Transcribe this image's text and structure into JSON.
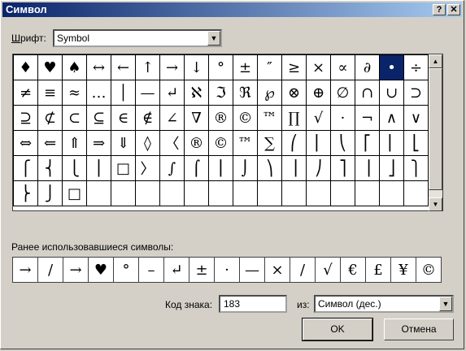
{
  "window": {
    "title": "Символ",
    "help": "?",
    "close": "X"
  },
  "font": {
    "label_pre": "Ш",
    "label_post": "рифт:",
    "label_ul": "",
    "value": "Symbol"
  },
  "grid": {
    "rows": [
      [
        "♦",
        "♥",
        "♠",
        "↔",
        "←",
        "↑",
        "→",
        "↓",
        "°",
        "±",
        "″",
        "≥",
        "×",
        "∝",
        "∂",
        "•",
        "÷"
      ],
      [
        "≠",
        "≡",
        "≈",
        "…",
        "│",
        "—",
        "↵",
        "ℵ",
        "ℑ",
        "ℜ",
        "℘",
        "⊗",
        "⊕",
        "∅",
        "∩",
        "∪",
        "⊃"
      ],
      [
        "⊇",
        "⊄",
        "⊂",
        "⊆",
        "∈",
        "∉",
        "∠",
        "∇",
        "®",
        "©",
        "™",
        "∏",
        "√",
        "·",
        "¬",
        "∧",
        "∨"
      ],
      [
        "⇔",
        "⇐",
        "⇑",
        "⇒",
        "⇓",
        "◊",
        "〈",
        "®",
        "©",
        "™",
        "∑",
        "⎛",
        "⎜",
        "⎝",
        "⎡",
        "⎢",
        "⎣"
      ],
      [
        "⎧",
        "⎨",
        "⎩",
        "⎪",
        "□",
        "〉",
        "∫",
        "⌠",
        "⎮",
        "⌡",
        "⎞",
        "⎟",
        "⎠",
        "⎤",
        "⎥",
        "⎦",
        "⎫"
      ],
      [
        "⎬",
        "⎭",
        "□",
        "",
        "",
        "",
        "",
        "",
        "",
        "",
        "",
        "",
        "",
        "",
        "",
        "",
        ""
      ]
    ],
    "selected": "0,15"
  },
  "recent": {
    "label": "Ранее использовавшиеся символы:",
    "symbols": [
      "→",
      "/",
      "→",
      "♥",
      "°",
      "–",
      "↵",
      "±",
      "·",
      "—",
      "×",
      "/",
      "√",
      "€",
      "£",
      "¥",
      "©"
    ]
  },
  "code": {
    "label": "Код знака:",
    "value": "183"
  },
  "from": {
    "label": "из:",
    "value": "Символ (дес.)"
  },
  "buttons": {
    "ok": "OK",
    "cancel": "Отмена"
  }
}
